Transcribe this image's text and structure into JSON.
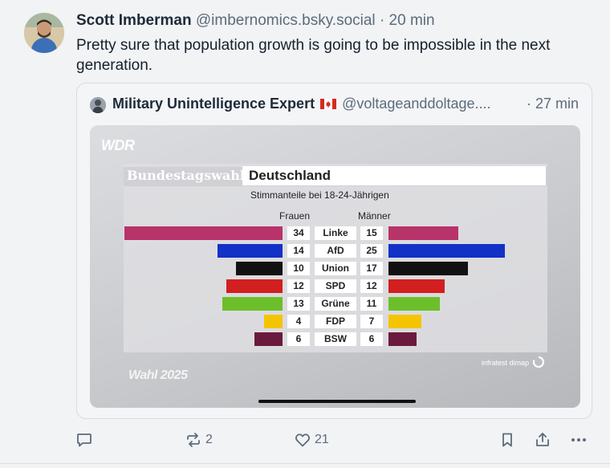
{
  "post": {
    "author_name": "Scott Imberman",
    "author_handle": "@imbernomics.bsky.social",
    "time": "· 20 min",
    "text": "Pretty sure that population growth is going to be impossible in the next generation."
  },
  "quote": {
    "author_name": "Military Unintelligence Expert",
    "flag_icon": "canada-flag-icon",
    "author_handle": "@voltageanddoltage....",
    "time": "· 27 min"
  },
  "media": {
    "brand": "WDR",
    "title_left": "Bundestagswahl",
    "title_right": "Deutschland",
    "subtitle": "Stimmanteile bei 18-24-Jährigen",
    "women_label": "Frauen",
    "men_label": "Männer",
    "source": "infratest dimap",
    "footer": "Wahl 2025",
    "parties": [
      {
        "name": "Linke",
        "women": 34,
        "men": 15,
        "color": "#b8336a"
      },
      {
        "name": "AfD",
        "women": 14,
        "men": 25,
        "color": "#1231c7"
      },
      {
        "name": "Union",
        "women": 10,
        "men": 17,
        "color": "#111111"
      },
      {
        "name": "SPD",
        "women": 12,
        "men": 12,
        "color": "#d21f1f"
      },
      {
        "name": "Grüne",
        "women": 13,
        "men": 11,
        "color": "#6cbf2a"
      },
      {
        "name": "FDP",
        "women": 4,
        "men": 7,
        "color": "#f5c400"
      },
      {
        "name": "BSW",
        "women": 6,
        "men": 6,
        "color": "#6b1a3d"
      }
    ]
  },
  "actions": {
    "reply_icon": "reply-icon",
    "repost_icon": "repost-icon",
    "repost_count": "2",
    "like_icon": "heart-icon",
    "like_count": "21",
    "bookmark_icon": "bookmark-icon",
    "share_icon": "share-icon",
    "more_icon": "more-icon"
  }
}
